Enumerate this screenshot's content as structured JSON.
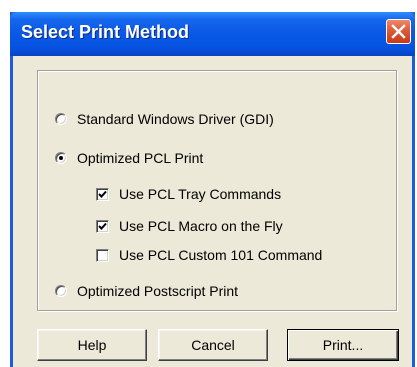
{
  "window": {
    "title": "Select Print Method",
    "close_icon": "close-icon"
  },
  "options": [
    {
      "label": "Standard Windows Driver (GDI)",
      "type": "radio",
      "checked": false
    },
    {
      "label": "Optimized PCL Print",
      "type": "radio",
      "checked": true
    },
    {
      "label": "Use PCL Tray Commands",
      "type": "checkbox",
      "checked": true
    },
    {
      "label": "Use PCL Macro on the Fly",
      "type": "checkbox",
      "checked": true
    },
    {
      "label": "Use PCL Custom 101 Command",
      "type": "checkbox",
      "checked": false
    },
    {
      "label": "Optimized Postscript Print",
      "type": "radio",
      "checked": false
    }
  ],
  "buttons": {
    "help": "Help",
    "cancel": "Cancel",
    "print": "Print..."
  },
  "colors": {
    "titlebar": "#0a58e6",
    "dialog_bg": "#ece9d8",
    "close_button": "#e05a35"
  }
}
